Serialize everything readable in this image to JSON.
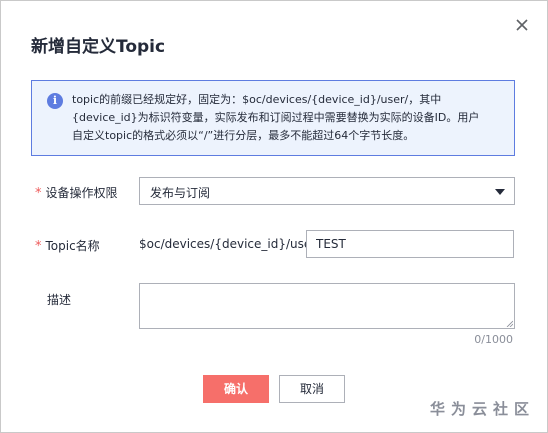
{
  "dialog": {
    "title": "新增自定义Topic",
    "close_icon": "close-icon"
  },
  "info": {
    "icon": "info-icon",
    "icon_glyph": "i",
    "lines": [
      "topic的前缀已经规定好，固定为：$oc/devices/{device_id}/user/，其中",
      "{device_id}为标识符变量，实际发布和订阅过程中需要替换为实际的设备ID。用户",
      "自定义topic的格式必须以“/”进行分层，最多不能超过64个字节长度。"
    ]
  },
  "form": {
    "required_mark": "*",
    "permission": {
      "label": "设备操作权限",
      "value": "发布与订阅"
    },
    "topic": {
      "label": "Topic名称",
      "prefix": "$oc/devices/{device_id}/user/",
      "value": "TEST"
    },
    "description": {
      "label": "描述",
      "value": "",
      "counter": "0/1000"
    }
  },
  "buttons": {
    "confirm": "确认",
    "cancel": "取消"
  },
  "watermark": "华为云社区",
  "colors": {
    "primary": "#f66f6a",
    "info_border": "#5e7ce0",
    "info_bg": "#edf3fd",
    "required": "#ee5a5a"
  }
}
